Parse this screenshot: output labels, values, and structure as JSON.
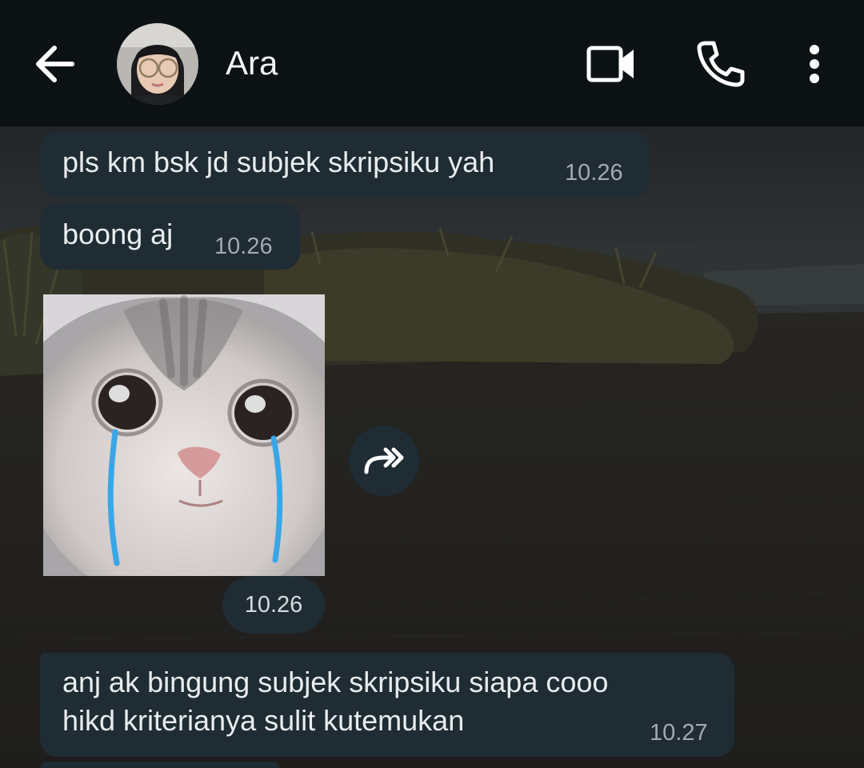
{
  "header": {
    "contact_name": "Ara",
    "back_icon": "arrow-left-icon",
    "video_icon": "video-camera-icon",
    "call_icon": "phone-icon",
    "menu_icon": "more-vert-icon"
  },
  "messages": [
    {
      "text": "pls km bsk jd subjek skripsiku yah",
      "time": "10.26"
    },
    {
      "text": "boong aj",
      "time": "10.26"
    },
    {
      "sticker": "crying-cat-sticker",
      "time": "10.26"
    },
    {
      "lines": [
        "anj ak bingung subjek skripsiku siapa cooo",
        "hikd kriterianya sulit kutemukan"
      ],
      "time": "10.27"
    }
  ],
  "colors": {
    "header_bg": "#0c1114",
    "bubble_bg": "#1f2c33",
    "text": "#e9edef",
    "time": "#a0abb1",
    "tear": "#3aa6e8"
  }
}
